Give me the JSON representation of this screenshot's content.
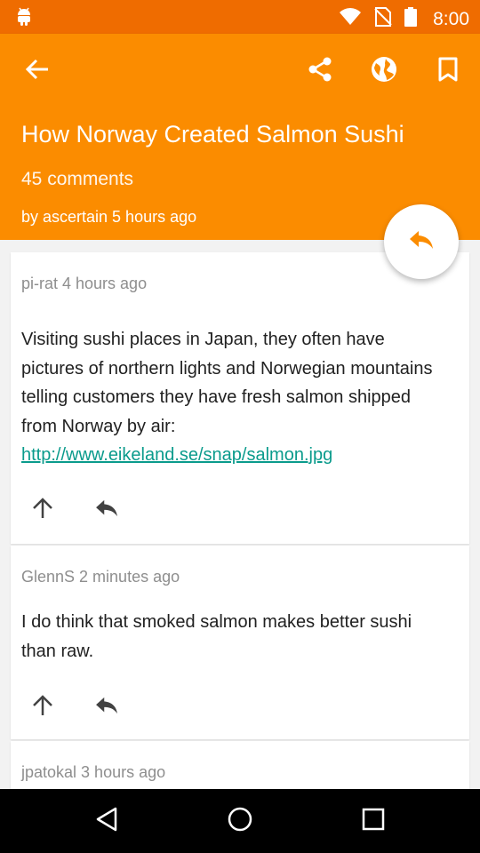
{
  "status_bar": {
    "time": "8:00",
    "icons": [
      "android-icon",
      "wifi-icon",
      "no-sim-icon",
      "battery-icon"
    ]
  },
  "toolbar": {
    "icons": [
      "back-arrow-icon",
      "share-icon",
      "globe-icon",
      "bookmark-icon"
    ]
  },
  "story": {
    "title": "How Norway Created Salmon Sushi",
    "comments_count": "45 comments",
    "byline": "by ascertain 5 hours ago"
  },
  "fab": {
    "icon": "reply-icon"
  },
  "comments": [
    {
      "meta": "pi-rat 4 hours ago",
      "text": "Visiting sushi places in Japan, they often have pictures of northern lights and Norwegian mountains telling customers they have fresh salmon shipped from Norway by air: ",
      "link": "http://www.eikeland.se/snap/salmon.jpg"
    },
    {
      "meta": "GlennS 2 minutes ago",
      "text": "I do think that smoked salmon makes better sushi than raw."
    },
    {
      "meta": "jpatokal 3 hours ago"
    }
  ],
  "colors": {
    "status_bar": "#ef6c00",
    "header": "#fb8c00",
    "link": "#0a9b8c",
    "fab_icon": "#fb8c00"
  },
  "nav_bar": {
    "icons": [
      "back-triangle-icon",
      "home-circle-icon",
      "recents-square-icon"
    ]
  }
}
